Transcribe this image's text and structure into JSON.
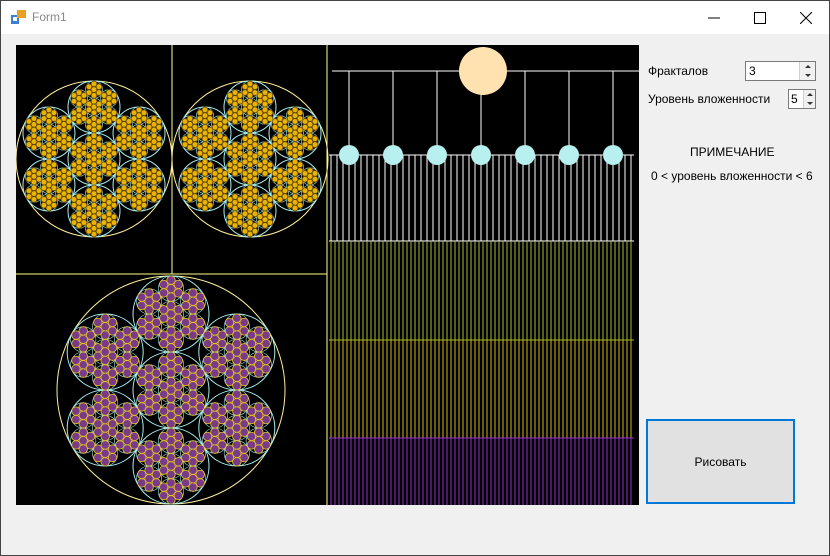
{
  "window": {
    "title": "Form1"
  },
  "controls": {
    "fractals_label": "Фракталов",
    "fractals_value": "3",
    "depth_label": "Уровень вложенности",
    "depth_value": "5",
    "note_title": "ПРИМЕЧАНИЕ",
    "note_text": "0 < уровень вложенности < 6",
    "draw_button": "Рисовать"
  },
  "colors": {
    "canvas_bg": "#000000",
    "divider": "#ffff80",
    "circle_outline_gold": "#ffef9a",
    "circle_outline_cyan": "#a8f0f0",
    "fill_gold": "#e8b400",
    "fill_purple": "#7a3a8a",
    "mesh_purple": "#e8c020",
    "sun": "#ffe2b0",
    "node_cyan": "#b8f0f0",
    "line_white": "#ffffff",
    "line_green": "#a8b830",
    "line_yellow": "#d4b800",
    "line_purple": "#9830d0",
    "accent": "#0078d7"
  },
  "icons": {
    "app": "app-icon",
    "minimize": "minimize-icon",
    "maximize": "maximize-icon",
    "close": "close-icon"
  }
}
